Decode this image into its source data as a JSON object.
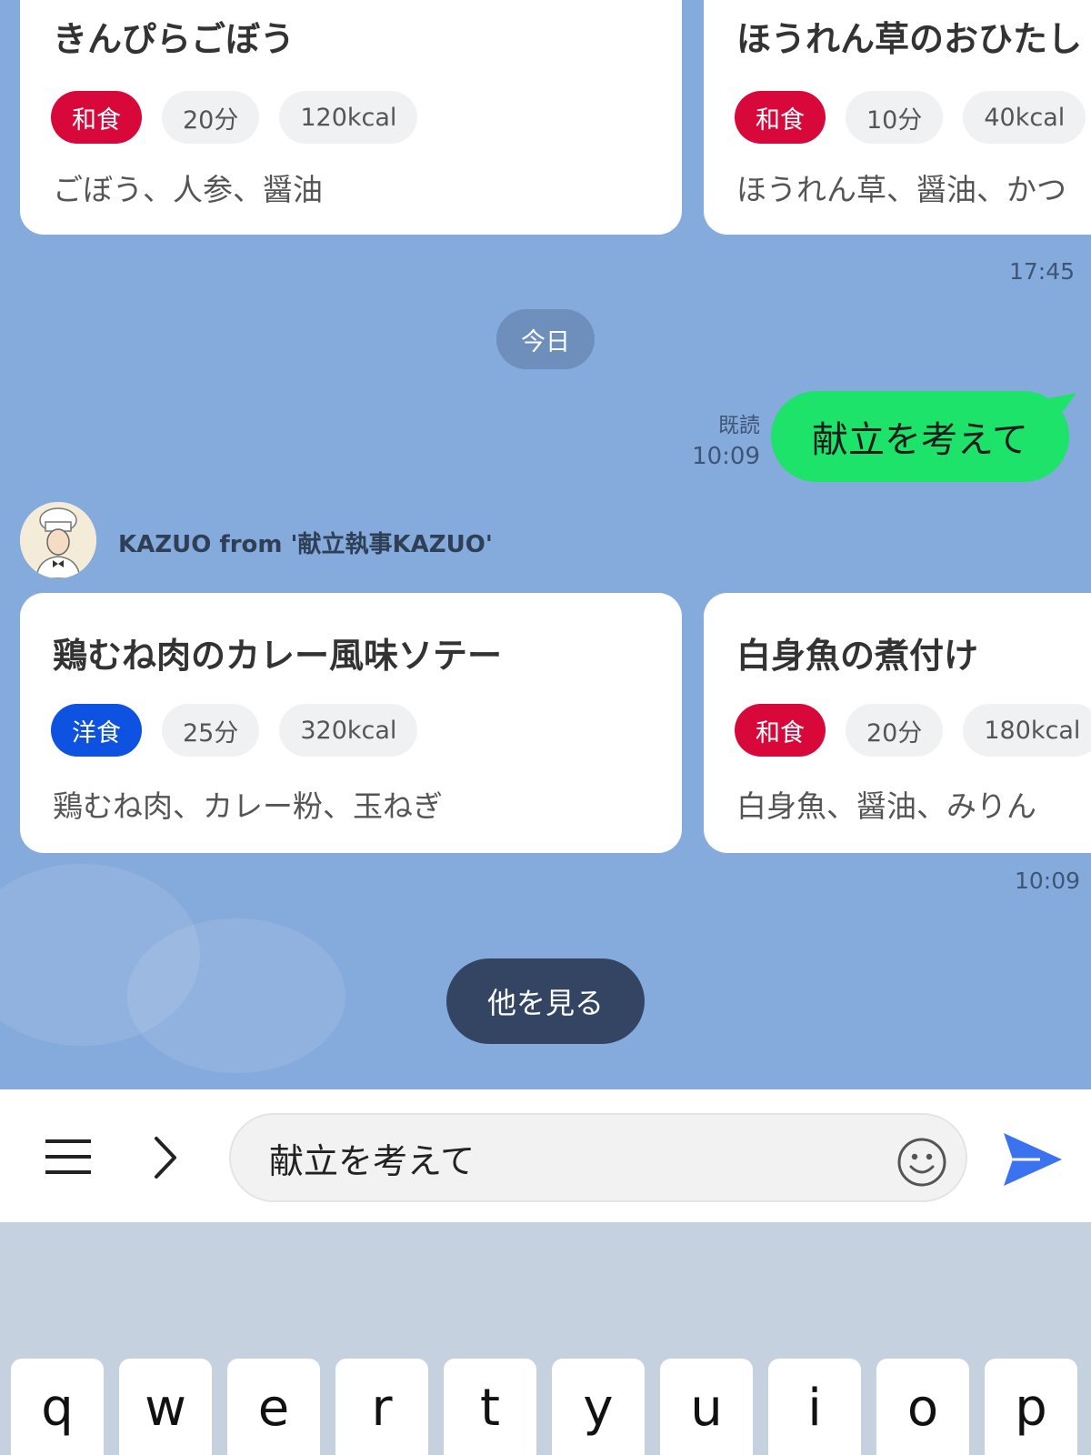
{
  "chat": {
    "earlier_cards": [
      {
        "title": "きんぴらごぼう",
        "cuisine": "和食",
        "time": "20分",
        "kcal": "120kcal",
        "ingredients": "ごぼう、人参、醤油"
      },
      {
        "title": "ほうれん草のおひたし",
        "cuisine": "和食",
        "time": "10分",
        "kcal": "40kcal",
        "ingredients": "ほうれん草、醤油、かつ"
      }
    ],
    "earlier_time": "17:45",
    "date_separator": "今日",
    "user_message": {
      "text": "献立を考えて",
      "read_label": "既読",
      "time": "10:09"
    },
    "bot": {
      "sender": "KAZUO from '献立執事KAZUO'"
    },
    "reply_cards": [
      {
        "title": "鶏むね肉のカレー風味ソテー",
        "cuisine": "洋食",
        "time": "25分",
        "kcal": "320kcal",
        "ingredients": "鶏むね肉、カレー粉、玉ねぎ"
      },
      {
        "title": "白身魚の煮付け",
        "cuisine": "和食",
        "time": "20分",
        "kcal": "180kcal",
        "ingredients": "白身魚、醤油、みりん"
      }
    ],
    "reply_time": "10:09",
    "more_button": "他を見る"
  },
  "input_bar": {
    "menu_icon": "hamburger-menu-icon",
    "expand_icon": "chevron-right-icon",
    "value": "献立を考えて",
    "emoji_icon": "smiley-icon",
    "send_icon": "send-arrow-icon"
  },
  "keyboard": {
    "keys": [
      "q",
      "w",
      "e",
      "r",
      "t",
      "y",
      "u",
      "i",
      "o",
      "p"
    ]
  },
  "colors": {
    "background": "#85aadc",
    "user_bubble": "#1ee36a",
    "japanese_tag": "#d9083a",
    "western_tag": "#0d52e0",
    "more_button": "#334562",
    "send": "#3b72f0"
  }
}
